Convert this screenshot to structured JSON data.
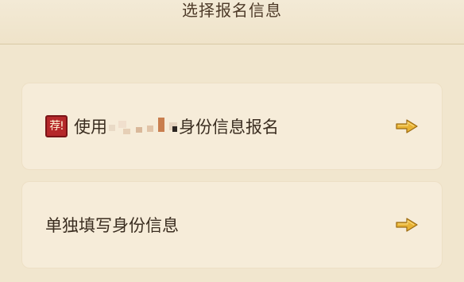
{
  "header": {
    "title": "选择报名信息"
  },
  "options": [
    {
      "badge": "荐!",
      "label_prefix": "使用",
      "label_suffix": "身份信息报名",
      "arrow_icon": "arrow-right-icon"
    },
    {
      "label": "单独填写身份信息",
      "arrow_icon": "arrow-right-icon"
    }
  ],
  "colors": {
    "background": "#f1e6ce",
    "card": "#f6ecd9",
    "badge": "#b5282a",
    "arrow": "#e2ad2e",
    "text": "#3a2d20"
  }
}
